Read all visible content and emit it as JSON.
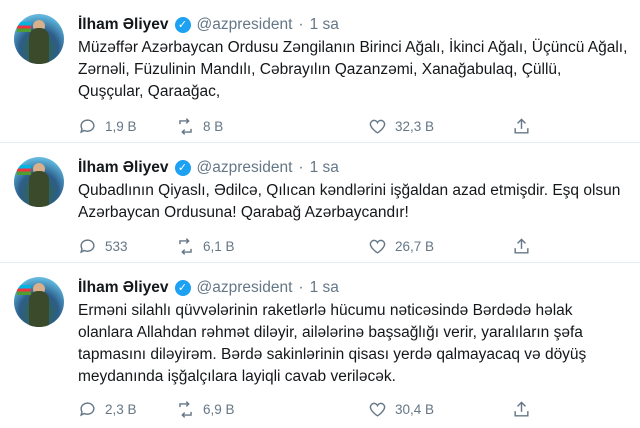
{
  "tweets": [
    {
      "author": "İlham Əliyev",
      "handle": "@azpresident",
      "separator": "·",
      "time": "1 sa",
      "text": "Müzəffər Azərbaycan Ordusu Zəngilanın Birinci Ağalı, İkinci Ağalı, Üçüncü Ağalı, Zərnəli, Füzulinin Mandılı, Cəbrayılın Qazanzəmi, Xanağabulaq, Çüllü, Quşçular, Qaraağac,",
      "replies": "1,9 B",
      "retweets": "8 B",
      "likes": "32,3 B"
    },
    {
      "author": "İlham Əliyev",
      "handle": "@azpresident",
      "separator": "·",
      "time": "1 sa",
      "text": "Qubadlının Qiyaslı, Ədilcə, Qılıcan kəndlərini işğaldan azad etmişdir. Eşq olsun Azərbaycan Ordusuna! Qarabağ Azərbaycandır!",
      "replies": "533",
      "retweets": "6,1 B",
      "likes": "26,7 B"
    },
    {
      "author": "İlham Əliyev",
      "handle": "@azpresident",
      "separator": "·",
      "time": "1 sa",
      "text": "Erməni silahlı qüvvələrinin raketlərlə hücumu nəticəsində Bərdədə həlak olanlara Allahdan rəhmət diləyir, ailələrinə başsağlığı verir, yaralıların şəfa tapmasını diləyirəm. Bərdə sakinlərinin qisası yerdə qalmayacaq və döyüş meydanında işğalçılara layiqli cavab veriləcək.",
      "replies": "2,3 B",
      "retweets": "6,9 B",
      "likes": "30,4 B"
    }
  ],
  "icons": {
    "reply": "reply-icon",
    "retweet": "retweet-icon",
    "like": "heart-icon",
    "share": "share-icon",
    "verified": "verified-badge-icon"
  },
  "colors": {
    "verified": "#1da1f2",
    "muted": "#657786",
    "text": "#14171a"
  }
}
